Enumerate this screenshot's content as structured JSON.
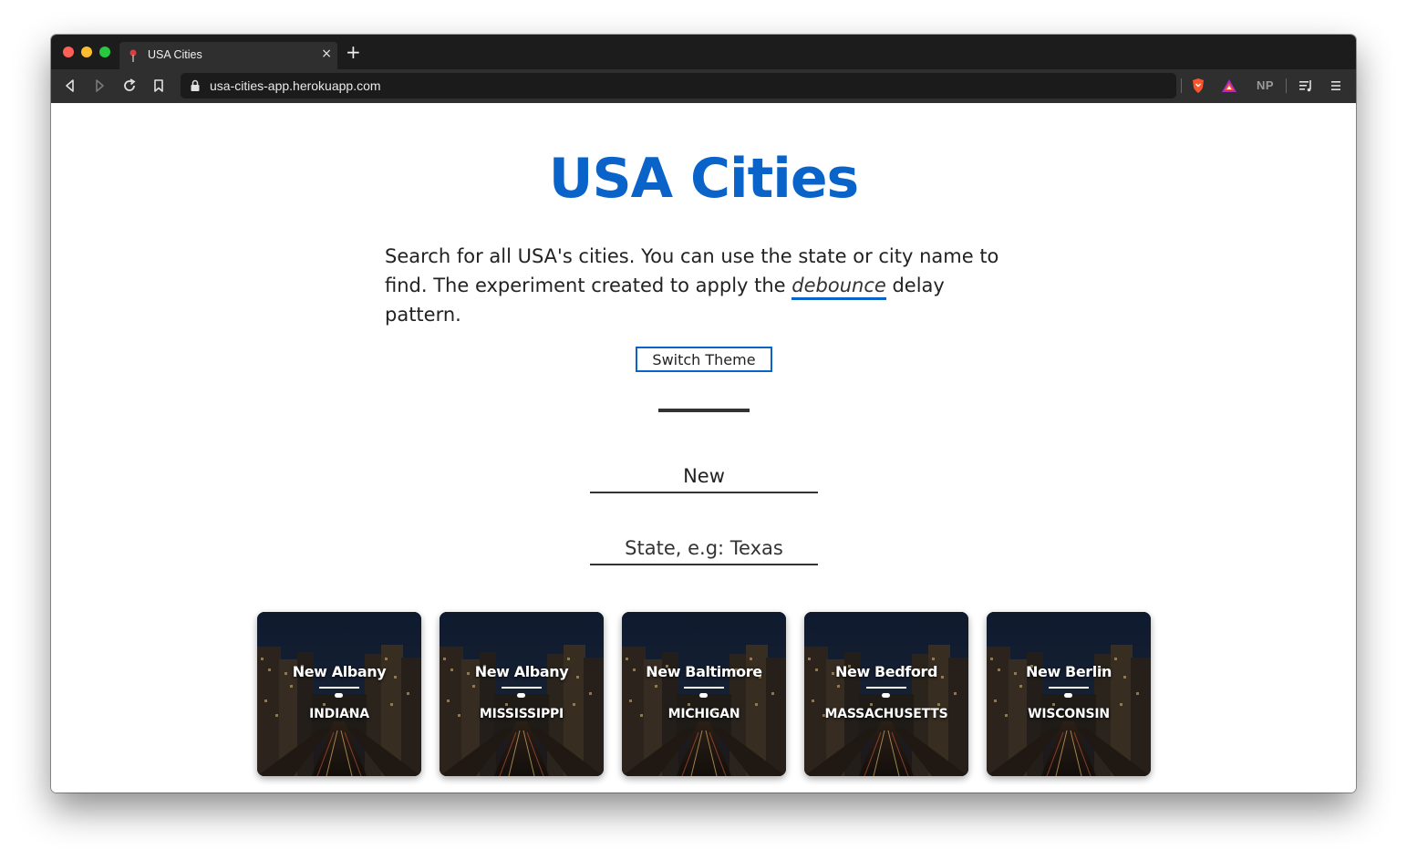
{
  "browser": {
    "tab_title": "USA Cities",
    "tab_close": "×",
    "new_tab": "+",
    "url": "usa-cities-app.herokuapp.com",
    "extension_label": "NP"
  },
  "page": {
    "title": "USA Cities",
    "description_before": "Search for all USA's cities. You can use the state or city name to find. The experiment created to apply the ",
    "description_highlight": "debounce",
    "description_after": " delay pattern.",
    "switch_theme_label": "Switch Theme",
    "city_input_value": "New",
    "state_input_placeholder": "State, e.g: Texas"
  },
  "cards": [
    {
      "city": "New Albany",
      "state": "INDIANA"
    },
    {
      "city": "New Albany",
      "state": "MISSISSIPPI"
    },
    {
      "city": "New Baltimore",
      "state": "MICHIGAN"
    },
    {
      "city": "New Bedford",
      "state": "MASSACHUSETTS"
    },
    {
      "city": "New Berlin",
      "state": "WISCONSIN"
    }
  ],
  "colors": {
    "accent": "#0a63c9",
    "chrome_dark": "#1c1c1c",
    "toolbar": "#2f2f2f"
  }
}
